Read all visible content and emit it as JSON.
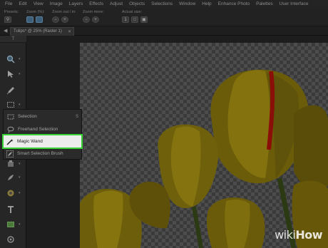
{
  "menubar": {
    "items": [
      "File",
      "Edit",
      "View",
      "Image",
      "Layers",
      "Effects",
      "Adjust",
      "Objects",
      "Selections",
      "Window",
      "Help",
      "Enhance Photo",
      "Palettes",
      "User Interface"
    ]
  },
  "toolbar": {
    "groups": [
      {
        "label": "Presets:"
      },
      {
        "label": "Zoom (%):"
      },
      {
        "label": "Zoom out / in:"
      },
      {
        "label": "Zoom more:"
      },
      {
        "label": "Actual size:"
      }
    ]
  },
  "document": {
    "tab_title": "Tulips* @ 25% (Raster 1)",
    "close_icon": "close-icon"
  },
  "tools_panel": {
    "header": "T",
    "tools": [
      {
        "name": "zoom-icon"
      },
      {
        "name": "pick-icon"
      },
      {
        "name": "dropper-icon"
      },
      {
        "name": "selection-icon"
      },
      {
        "name": "clone-icon"
      },
      {
        "name": "paint-icon"
      },
      {
        "name": "dodge-icon"
      },
      {
        "name": "text-icon"
      },
      {
        "name": "shape-icon"
      },
      {
        "name": "settings-icon"
      }
    ]
  },
  "flyout": {
    "items": [
      {
        "label": "Selection",
        "key": "S",
        "icon": "rectangle-select-icon"
      },
      {
        "label": "Freehand Selection",
        "key": "",
        "icon": "lasso-icon"
      },
      {
        "label": "Magic Wand",
        "key": "",
        "icon": "magic-wand-icon",
        "highlighted": true
      },
      {
        "label": "Smart Selection Brush",
        "key": "",
        "icon": "brush-select-icon"
      }
    ],
    "highlight_color": "#39d236"
  },
  "watermark": {
    "part1": "wiki",
    "part2": "How"
  }
}
